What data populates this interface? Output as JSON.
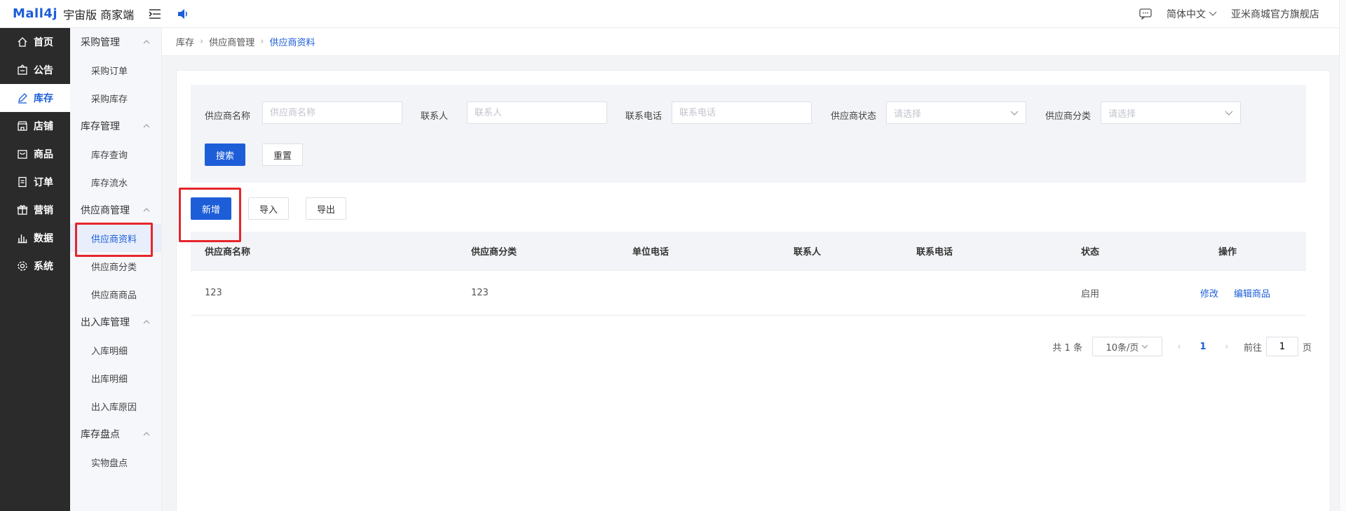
{
  "header": {
    "logo": "Mall4j",
    "subtitle": "宇宙版 商家端",
    "language": "简体中文",
    "shop_name": "亚米商城官方旗舰店"
  },
  "sidebar": {
    "items": [
      {
        "label": "首页",
        "icon": "home-icon"
      },
      {
        "label": "公告",
        "icon": "notice-icon"
      },
      {
        "label": "库存",
        "icon": "edit-icon",
        "active": true
      },
      {
        "label": "店铺",
        "icon": "shop-icon"
      },
      {
        "label": "商品",
        "icon": "goods-icon"
      },
      {
        "label": "订单",
        "icon": "order-icon"
      },
      {
        "label": "营销",
        "icon": "gift-icon"
      },
      {
        "label": "数据",
        "icon": "chart-icon"
      },
      {
        "label": "系统",
        "icon": "gear-icon"
      }
    ]
  },
  "submenu": {
    "groups": [
      {
        "title": "采购管理",
        "items": [
          "采购订单",
          "采购库存"
        ]
      },
      {
        "title": "库存管理",
        "items": [
          "库存查询",
          "库存流水"
        ]
      },
      {
        "title": "供应商管理",
        "items": [
          "供应商资料",
          "供应商分类",
          "供应商商品"
        ]
      },
      {
        "title": "出入库管理",
        "items": [
          "入库明细",
          "出库明细",
          "出入库原因"
        ]
      },
      {
        "title": "库存盘点",
        "items": [
          "实物盘点"
        ]
      }
    ]
  },
  "breadcrumb": [
    "库存",
    "供应商管理",
    "供应商资料"
  ],
  "filters": {
    "name_label": "供应商名称",
    "name_placeholder": "供应商名称",
    "contact_label": "联系人",
    "contact_placeholder": "联系人",
    "phone_label": "联系电话",
    "phone_placeholder": "联系电话",
    "status_label": "供应商状态",
    "status_placeholder": "请选择",
    "category_label": "供应商分类",
    "category_placeholder": "请选择",
    "search_label": "搜索",
    "reset_label": "重置"
  },
  "actions": {
    "add_label": "新增",
    "import_label": "导入",
    "export_label": "导出"
  },
  "table": {
    "headers": [
      "供应商名称",
      "供应商分类",
      "单位电话",
      "联系人",
      "联系电话",
      "状态",
      "操作"
    ],
    "rows": [
      {
        "name": "123",
        "category": "123",
        "unit_phone": "",
        "contact": "",
        "phone": "",
        "status": "启用",
        "edit_label": "修改",
        "edit_goods_label": "编辑商品"
      }
    ]
  },
  "pagination": {
    "total_text": "共 1 条",
    "page_size": "10条/页",
    "current_page": "1",
    "goto_label": "前往",
    "goto_value": "1",
    "page_suffix": "页"
  },
  "colors": {
    "accent": "#1d5ed8",
    "sidebar_bg": "#2b2b2b",
    "highlight": "#e7252a"
  }
}
